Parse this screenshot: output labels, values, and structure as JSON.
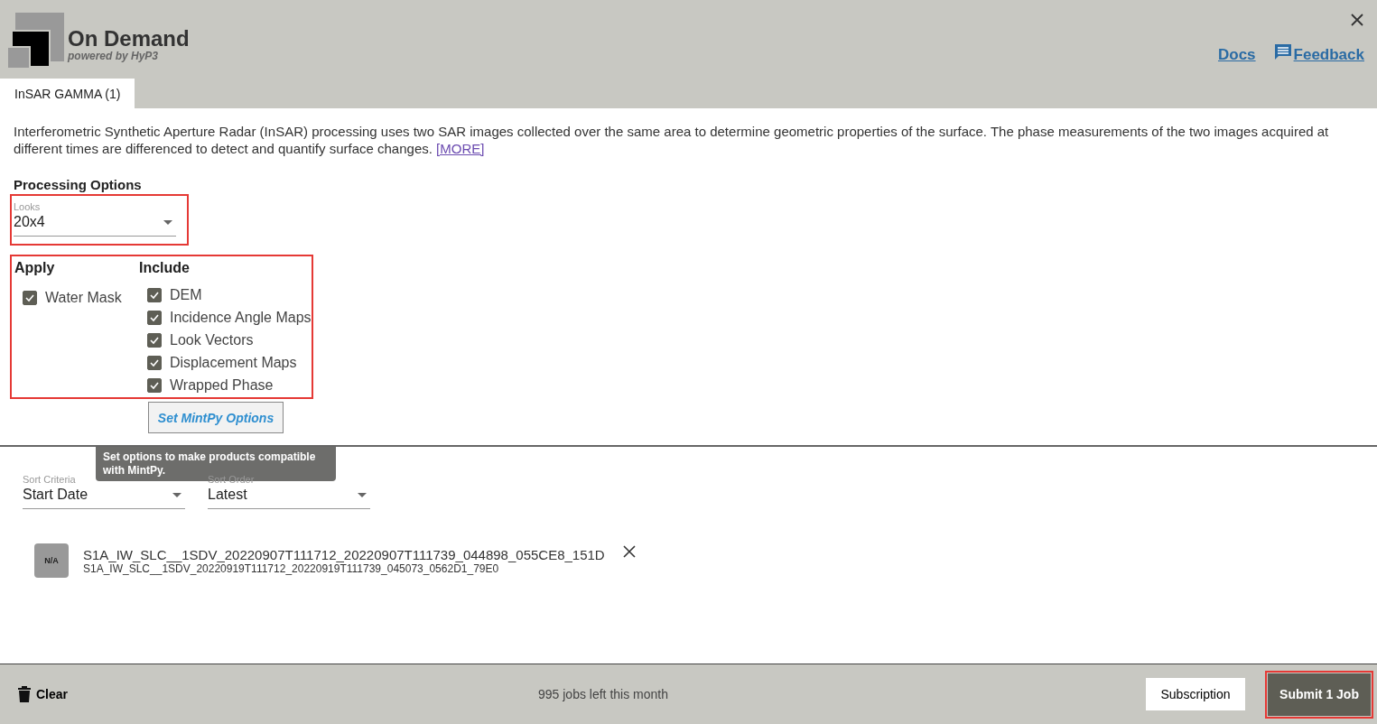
{
  "header": {
    "title": "On Demand",
    "subtitle": "powered by HyP3",
    "links": [
      {
        "label": "Docs",
        "kind": "text"
      },
      {
        "label": "Feedback",
        "kind": "feedback"
      }
    ]
  },
  "tabs": [
    {
      "label": "InSAR GAMMA (1)",
      "selected": true
    }
  ],
  "description": {
    "text": "Interferometric Synthetic Aperture Radar (InSAR) processing uses two SAR images collected over the same area to determine geometric properties of the surface. The phase measurements of the two images acquired at different times are differenced to detect and quantify surface changes.",
    "link": "[MORE]"
  },
  "processing_options": {
    "title": "Processing Options",
    "looks": {
      "label": "Looks",
      "value": "20x4",
      "highlighted": true
    },
    "options_highlighted": true,
    "apply": {
      "title": "Apply",
      "items": [
        {
          "label": "Water Mask",
          "checked": true
        }
      ]
    },
    "include": {
      "title": "Include",
      "items": [
        {
          "label": "DEM",
          "checked": true
        },
        {
          "label": "Incidence Angle Maps",
          "checked": true
        },
        {
          "label": "Look Vectors",
          "checked": true
        },
        {
          "label": "Displacement Maps",
          "checked": true
        },
        {
          "label": "Wrapped Phase",
          "checked": true
        }
      ]
    },
    "mintpy_button": "Set MintPy Options",
    "tooltip": "Set options to make products compatible with MintPy."
  },
  "sort": [
    {
      "label": "Sort Criteria",
      "value": "Start Date"
    },
    {
      "label": "Sort Order",
      "value": "Latest"
    }
  ],
  "jobs": [
    {
      "thumbnail": "N/A",
      "scenes": [
        "S1A_IW_SLC__1SDV_20220907T111712_20220907T111739_044898_055CE8_151D",
        "S1A_IW_SLC__1SDV_20220919T111712_20220919T111739_045073_0562D1_79E0"
      ]
    }
  ],
  "footer": {
    "clear": "Clear",
    "jobs_left": "995 jobs left this month",
    "subscription": "Subscription",
    "submit": "Submit 1 Job",
    "submit_highlighted": true
  }
}
